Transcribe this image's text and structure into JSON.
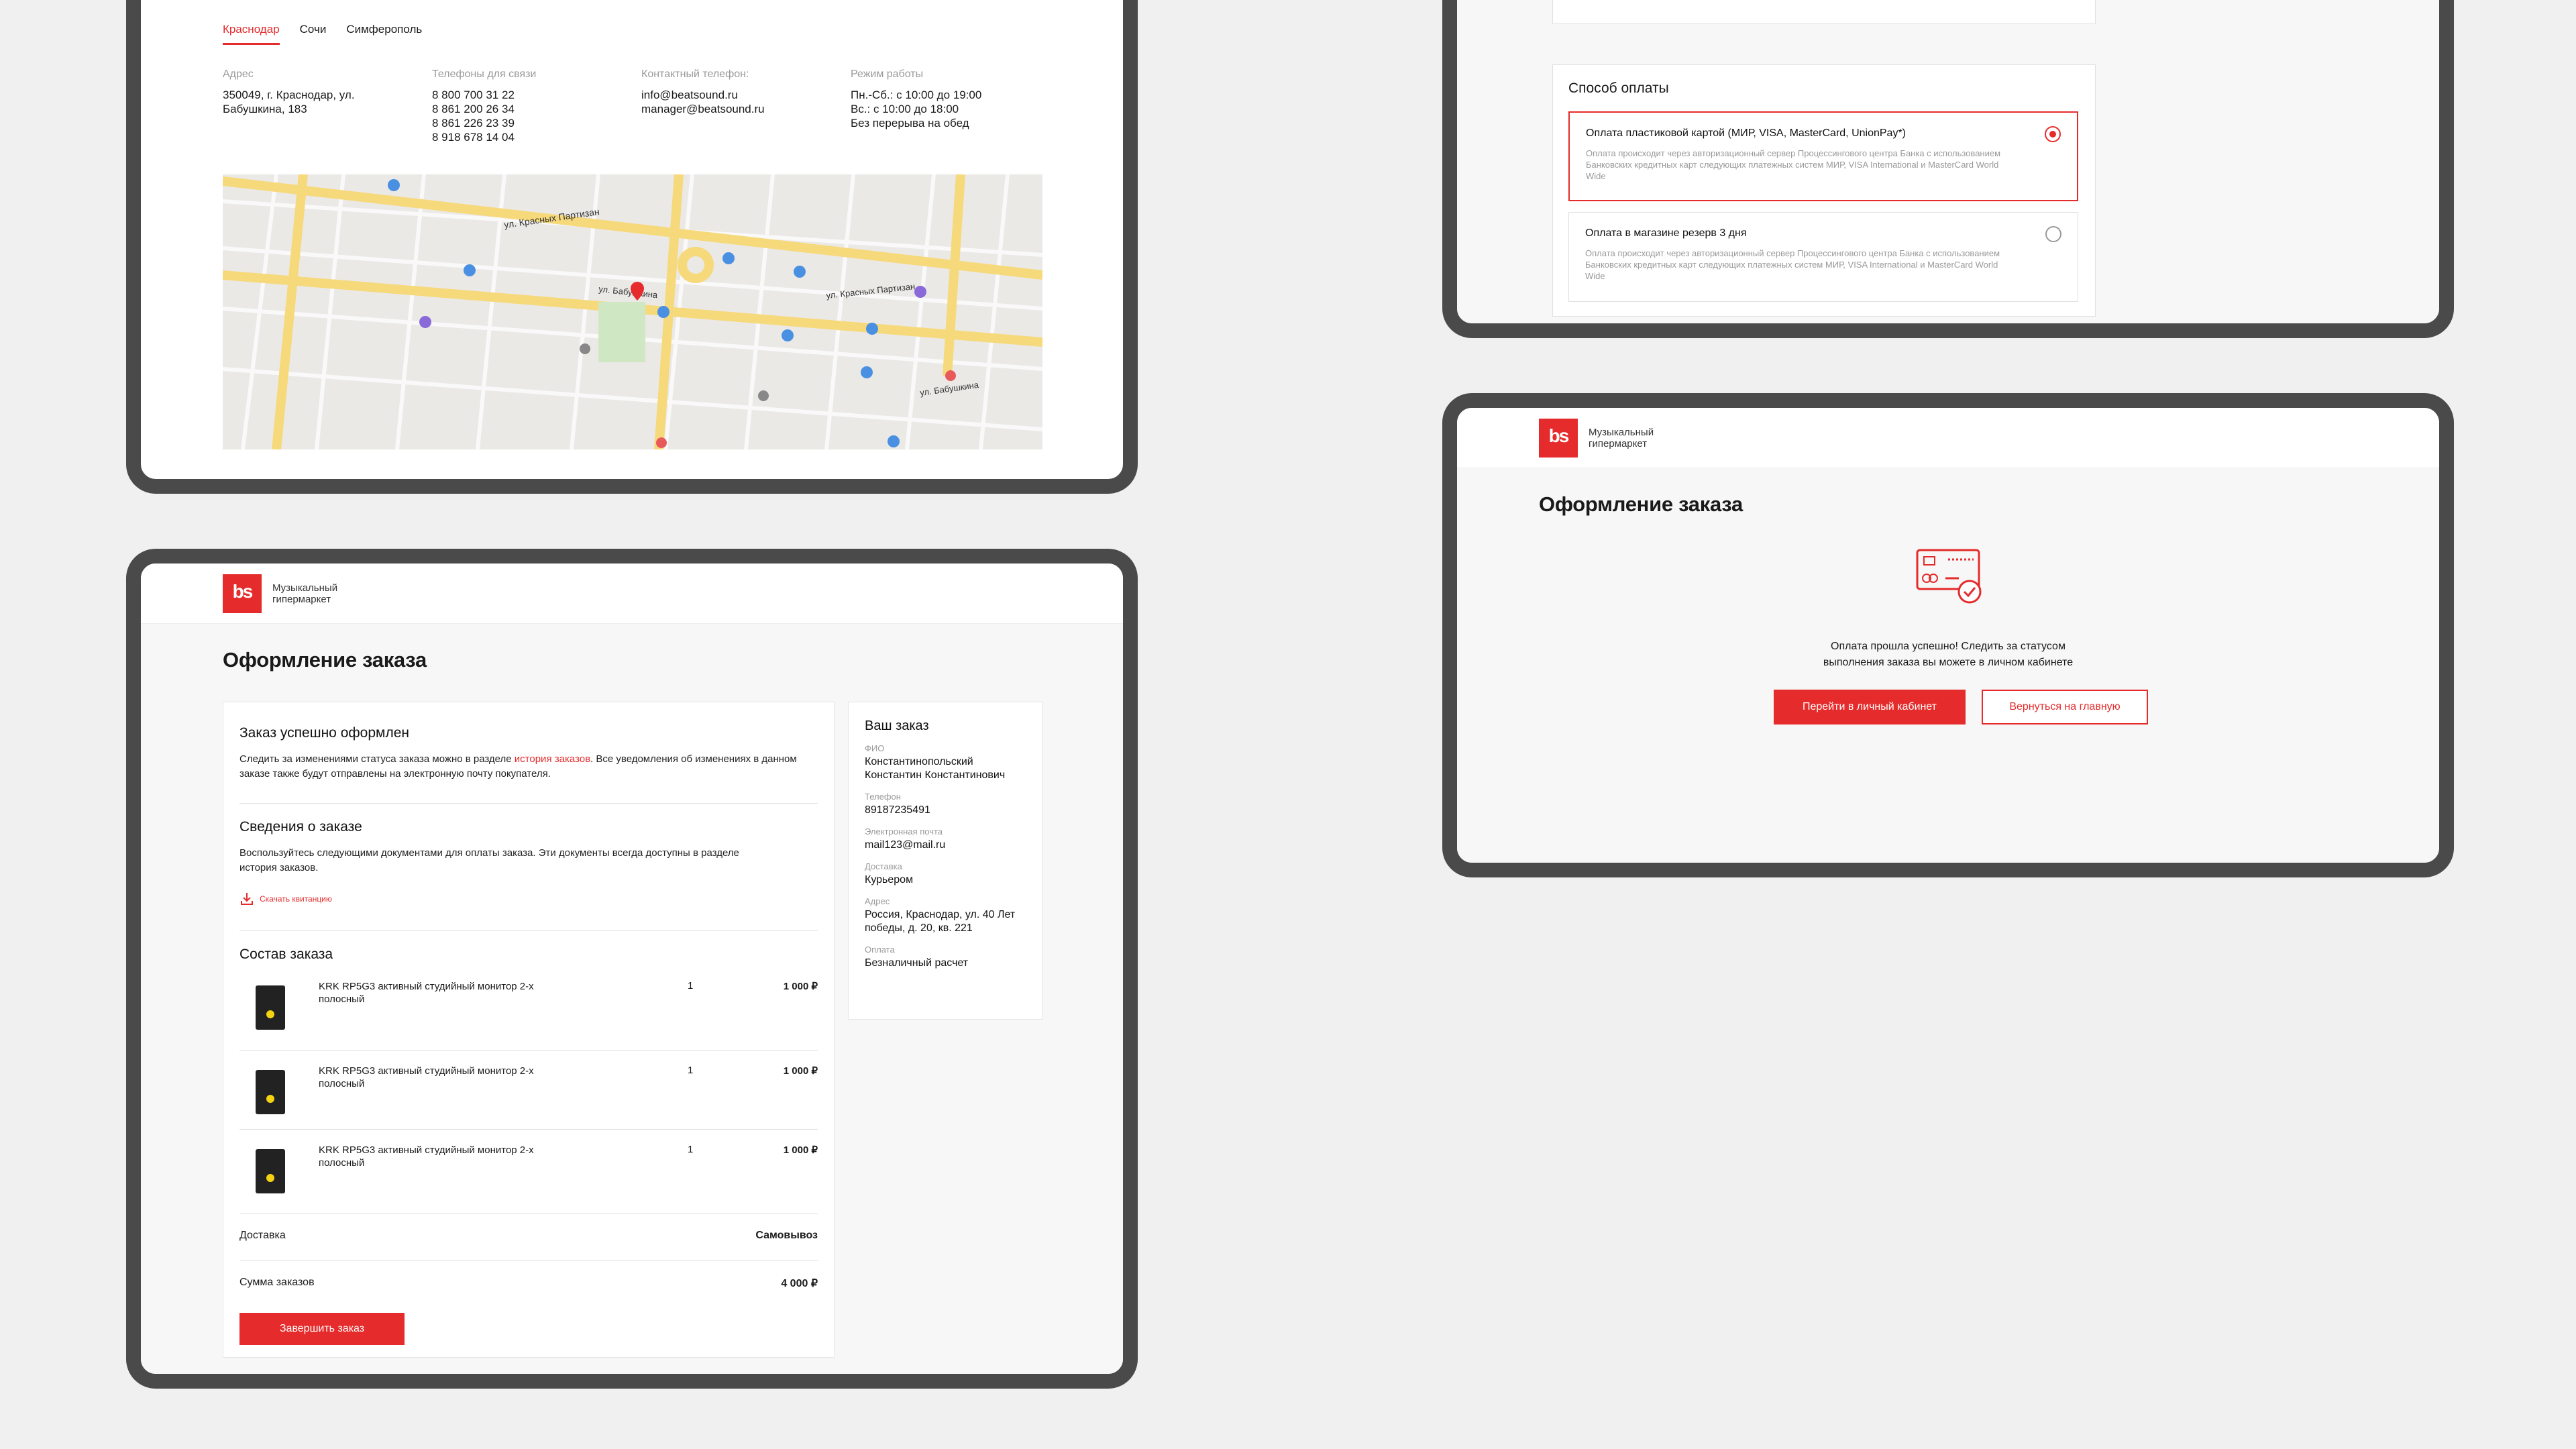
{
  "contacts": {
    "tabs": [
      "Краснодар",
      "Сочи",
      "Симферополь"
    ],
    "address_label": "Адрес",
    "address": [
      "350049, г. Краснодар, ул.",
      "Бабушкина, 183"
    ],
    "phones_label": "Телефоны для связи",
    "phones": [
      "8 800 700 31 22",
      "8 861 200 26 34",
      "8 861 226 23 39",
      "8 918 678 14 04"
    ],
    "contact_label": "Контактный телефон:",
    "emails": [
      "info@beatsound.ru",
      "manager@beatsound.ru"
    ],
    "hours_label": "Режим работы",
    "hours": [
      "Пн.-Сб.: с 10:00 до 19:00",
      "Вс.: с 10:00 до 18:00",
      "Без перерыва на обед"
    ],
    "map_labels": {
      "street1": "ул. Красных Партизан",
      "street2": "ул. Бабушкина",
      "street3": "ул. Красных Партизан",
      "street4": "ул. Бабушкина"
    }
  },
  "header": {
    "logo": "bs",
    "tagline": "Музыкальный гипермаркет"
  },
  "checkout": {
    "title": "Оформление заказа",
    "success_title": "Заказ успешно оформлен",
    "success_text_before": "Следить за изменениями статуса заказа можно в разделе ",
    "success_link": "история заказов",
    "success_text_after": ". Все уведомления об изменениях в данном заказе также будут отправлены на электронную почту покупателя.",
    "docs_title": "Сведения о заказе",
    "docs_text": "Воспользуйтесь следующими документами для оплаты заказа. Эти документы всегда доступны в разделе история заказов.",
    "download_label": "Скачать квитанцию",
    "items_title": "Состав заказа",
    "items": [
      {
        "name": "KRK RP5G3 активный студийный монитор 2-х полосный",
        "qty": "1",
        "price": "1 000 ₽"
      },
      {
        "name": "KRK RP5G3 активный студийный монитор 2-х полосный",
        "qty": "1",
        "price": "1 000 ₽"
      },
      {
        "name": "KRK RP5G3 активный студийный монитор 2-х полосный",
        "qty": "1",
        "price": "1 000 ₽"
      }
    ],
    "delivery_label": "Доставка",
    "delivery_value": "Самовывоз",
    "total_label": "Сумма заказов",
    "total_value": "4 000 ₽",
    "finish_button": "Завершить заказ"
  },
  "order_summary": {
    "title": "Ваш заказ",
    "fio_label": "ФИО",
    "fio": "Константинопольский Константин Константинович",
    "phone_label": "Телефон",
    "phone": "89187235491",
    "email_label": "Электронная почта",
    "email": "mail123@mail.ru",
    "delivery_label": "Доставка",
    "delivery": "Курьером",
    "address_label": "Адрес",
    "address": "Россия, Краснодар, ул. 40 Лет победы, д. 20, кв. 221",
    "payment_label": "Оплата",
    "payment": "Безналичный расчет"
  },
  "payment": {
    "title": "Способ оплаты",
    "options": [
      {
        "title": "Оплата пластиковой картой (МИР, VISA, MasterCard, UnionPay*)",
        "desc": "Оплата происходит через авторизационный сервер Процессингового центра Банка с использованием Банковских кредитных карт следующих платежных систем МИР, VISA International и MasterCard World Wide",
        "selected": true
      },
      {
        "title": "Оплата в магазине резерв 3 дня",
        "desc": "Оплата происходит через авторизационный сервер Процессингового центра Банка с использованием Банковских кредитных карт следующих платежных систем МИР, VISA International и MasterCard World Wide",
        "selected": false
      }
    ]
  },
  "success": {
    "title": "Оформление заказа",
    "message": "Оплата прошла успешно! Следить за статусом выполнения заказа вы можете в личном кабинете",
    "primary_button": "Перейти в личный кабинет",
    "secondary_button": "Вернуться на главную"
  },
  "colors": {
    "accent": "#e52b2b",
    "frame": "#4a4a4a",
    "background": "#f0f0f0"
  }
}
